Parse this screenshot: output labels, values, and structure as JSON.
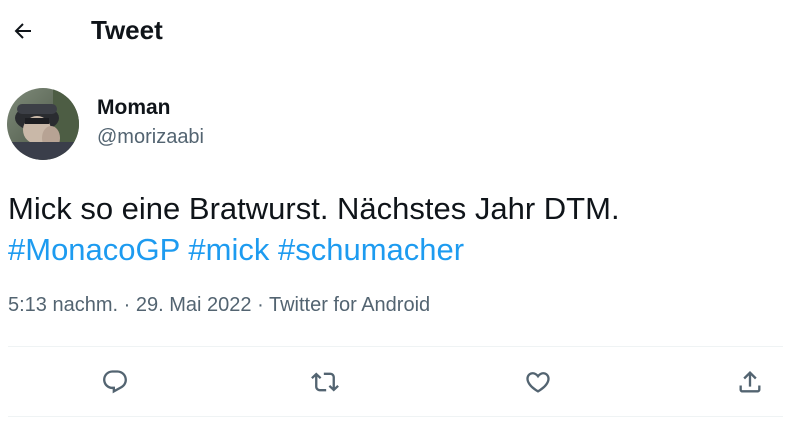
{
  "header": {
    "back_icon": "arrow-left-icon",
    "title": "Tweet"
  },
  "author": {
    "display_name": "Moman",
    "handle": "@morizaabi"
  },
  "tweet": {
    "text": "Mick so eine Bratwurst. Nächstes Jahr DTM.",
    "hashtags": [
      "#MonacoGP",
      "#mick",
      "#schumacher"
    ]
  },
  "meta": {
    "time": "5:13 nachm.",
    "separator": "·",
    "date": "29. Mai 2022",
    "source": "Twitter for Android"
  },
  "actions": [
    {
      "icon": "reply-icon"
    },
    {
      "icon": "retweet-icon"
    },
    {
      "icon": "like-icon"
    },
    {
      "icon": "share-icon"
    }
  ],
  "colors": {
    "text": "#0f1419",
    "secondary": "#536471",
    "link": "#1d9bf0",
    "divider": "#eff3f4"
  }
}
